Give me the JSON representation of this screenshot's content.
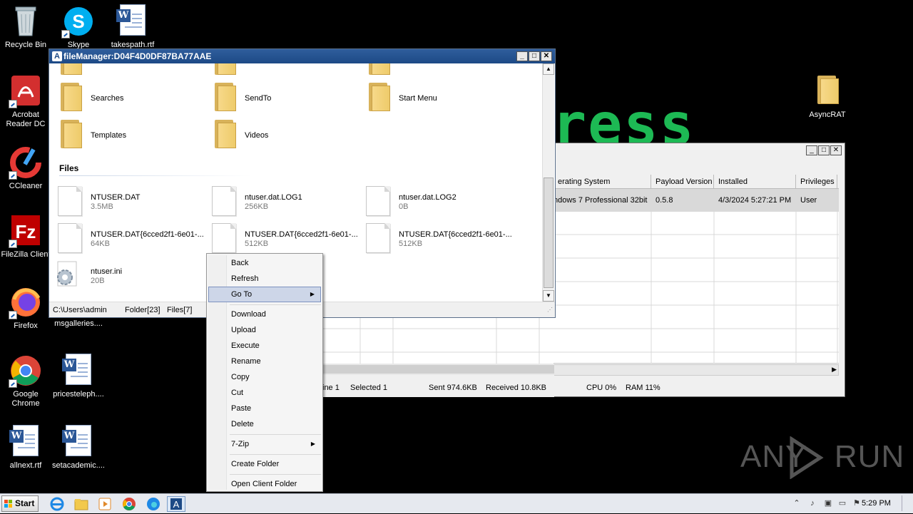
{
  "desktop": {
    "icons": [
      {
        "label": "Recycle Bin"
      },
      {
        "label": "Skype"
      },
      {
        "label": "takespath.rtf"
      },
      {
        "label": "Acrobat Reader DC"
      },
      {
        "label": "CCleaner"
      },
      {
        "label": "FileZilla Client"
      },
      {
        "label": "Firefox"
      },
      {
        "label": "msgalleries...."
      },
      {
        "label": "Google Chrome"
      },
      {
        "label": "pricesteleph...."
      },
      {
        "label": "allnext.rtf"
      },
      {
        "label": "setacademic...."
      },
      {
        "label": "AsyncRAT"
      }
    ],
    "background_text": "ress",
    "watermark": "ANY RUN"
  },
  "rat_window": {
    "columns": [
      "erating System",
      "Payload Version",
      "Installed",
      "Privileges"
    ],
    "row": {
      "os": "ndows 7 Professional  32bit",
      "payload": "0.5.8",
      "installed": "4/3/2024 5:27:21 PM",
      "privileges": "User"
    },
    "status": {
      "line": "ine 1",
      "selected": "Selected 1",
      "sent": "Sent 974.6KB",
      "received": "Received 10.8KB",
      "cpu": "CPU 0%",
      "ram": "RAM 11%"
    }
  },
  "file_manager": {
    "title": "fileManager:D04F4D0DF87BA77AAE",
    "folders": [
      {
        "name": "Searches"
      },
      {
        "name": "SendTo"
      },
      {
        "name": "Start Menu"
      },
      {
        "name": "Templates"
      },
      {
        "name": "Videos"
      }
    ],
    "files_heading": "Files",
    "files": [
      {
        "name": "NTUSER.DAT",
        "size": "3.5MB"
      },
      {
        "name": "ntuser.dat.LOG1",
        "size": "256KB"
      },
      {
        "name": "ntuser.dat.LOG2",
        "size": "0B"
      },
      {
        "name": "NTUSER.DAT{6cced2f1-6e01-...",
        "size": "64KB"
      },
      {
        "name": "NTUSER.DAT{6cced2f1-6e01-...",
        "size": "512KB"
      },
      {
        "name": "NTUSER.DAT{6cced2f1-6e01-...",
        "size": "512KB"
      },
      {
        "name": "ntuser.ini",
        "size": "20B"
      }
    ],
    "status": {
      "path": "C:\\Users\\admin",
      "folders": "Folder[23]",
      "files": "Files[7]"
    }
  },
  "context_menu": {
    "items": [
      "Back",
      "Refresh",
      "Go To",
      "Download",
      "Upload",
      "Execute",
      "Rename",
      "Copy",
      "Cut",
      "Paste",
      "Delete",
      "7-Zip",
      "Create Folder",
      "Open Client Folder"
    ]
  },
  "taskbar": {
    "start_label": "Start",
    "clock": "5:29 PM"
  },
  "colors": {
    "titlebar": "#1d4a86",
    "menu_highlight": "#cdd6e8",
    "bg_text": "#1db954"
  }
}
